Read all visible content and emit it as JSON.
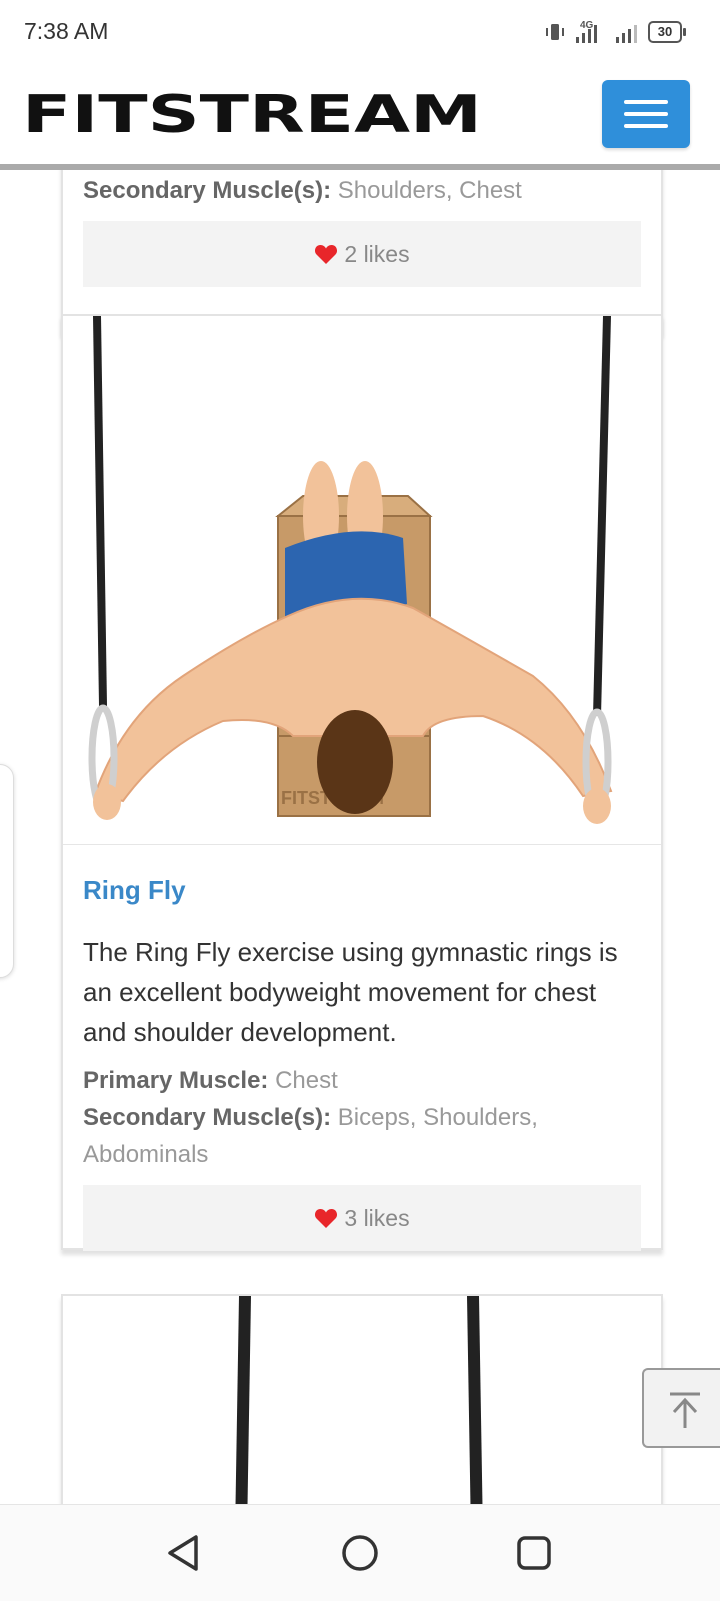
{
  "status_bar": {
    "time": "7:38 AM",
    "network": "4G",
    "battery": "30"
  },
  "header": {
    "logo_text": "FITSTREAM",
    "menu_icon": "hamburger-icon"
  },
  "cards": [
    {
      "secondary_label": "Secondary Muscle(s):",
      "secondary_value": "Shoulders, Chest",
      "likes": "2 likes"
    },
    {
      "title": "Ring Fly",
      "description": "The Ring Fly exercise using gymnastic rings is an excellent bodyweight movement for chest and shoulder development.",
      "primary_label": "Primary Muscle:",
      "primary_value": "Chest",
      "secondary_label": "Secondary Muscle(s):",
      "secondary_value": "Biceps, Shoulders, Abdominals",
      "likes": "3 likes",
      "image_watermark": "FITSTREAM"
    }
  ],
  "colors": {
    "accent": "#2f8fda",
    "title": "#3a88c8",
    "heart": "#e8262a",
    "likes_bg": "#f3f3f3"
  },
  "navigation": {
    "back": "back-icon",
    "home": "home-icon",
    "recents": "recents-icon"
  }
}
